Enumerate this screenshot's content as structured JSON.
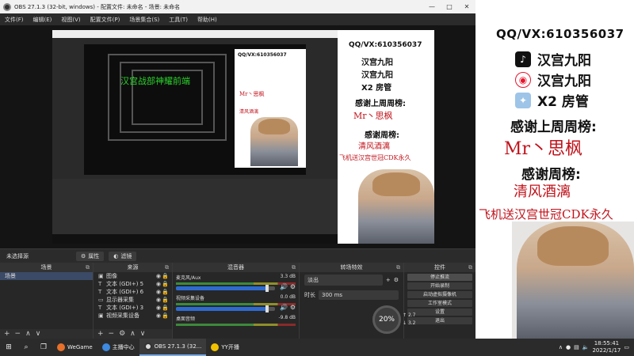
{
  "obs": {
    "title": "OBS 27.1.3 (32-bit, windows) - 配置文件: 未命名 - 场景: 未命名",
    "menu": [
      "文件(F)",
      "编辑(E)",
      "视图(V)",
      "配置文件(P)",
      "场景集合(S)",
      "工具(T)",
      "帮助(H)"
    ],
    "no_source": "未选择源",
    "properties_label": "属性",
    "filters_label": "滤镜",
    "docks": {
      "scenes": {
        "title": "场景",
        "items": [
          "场景"
        ]
      },
      "sources": {
        "title": "来源",
        "items": [
          {
            "icon": "▣",
            "name": "图像"
          },
          {
            "icon": "T",
            "name": "文本 (GDI+) 5"
          },
          {
            "icon": "T",
            "name": "文本 (GDI+) 6"
          },
          {
            "icon": "▭",
            "name": "显示器采集"
          },
          {
            "icon": "T",
            "name": "文本 (GDI+) 3"
          },
          {
            "icon": "▣",
            "name": "视频采集设备"
          }
        ]
      },
      "mixer": {
        "title": "混音器",
        "channels": [
          {
            "name": "麦克风/Aux",
            "db": "3.3 dB",
            "level": 0.92
          },
          {
            "name": "视频采集设备",
            "db": "0.0 dB",
            "level": 0.92
          },
          {
            "name": "桌面音频",
            "db": "-9.8 dB",
            "level": 0.8
          }
        ]
      },
      "transitions": {
        "title": "转场特效",
        "type": "淡出",
        "duration_label": "时长",
        "duration": "300 ms"
      },
      "controls": {
        "title": "控件",
        "buttons": [
          "停止推流",
          "开始录制",
          "启动虚拟摄像机",
          "工作室模式",
          "设置",
          "退出"
        ]
      }
    },
    "stats": {
      "cpu": "20%",
      "up": "2.7",
      "down": "3.2"
    }
  },
  "overlay": {
    "qq": "QQ/VX:610356037",
    "douyin": "汉宫九阳",
    "weibo": "汉宫九阳",
    "guan": "X2 房管",
    "last_week_title": "感谢上周周榜:",
    "last_week_name": "Mr丶思枫",
    "this_week_title": "感谢周榜:",
    "this_week_name": "清风酒漓",
    "cdk": "飞机送汉宫世冠CDK永久",
    "scroll_text": "汉宫战部神耀前端"
  },
  "taskbar": {
    "apps": [
      {
        "label": "WeGame",
        "color": "#e8702a"
      },
      {
        "label": "主播中心",
        "color": "#3d8ae0"
      },
      {
        "label": "OBS 27.1.3 (32...",
        "color": "#dddddd"
      },
      {
        "label": "YY开播",
        "color": "#f2c200"
      }
    ],
    "time": "18:55:41",
    "date": "2022/1/17"
  },
  "colors": {
    "accent": "#c0131b",
    "selection": "#3b4a66",
    "fader": "#2e6bd0"
  }
}
